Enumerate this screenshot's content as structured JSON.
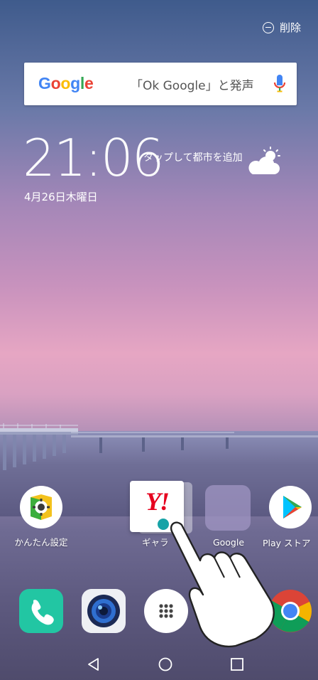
{
  "topbar": {
    "delete_label": "削除"
  },
  "search": {
    "logo": "Google",
    "hint": "「Ok Google」と発声"
  },
  "clock": {
    "time": "21:06",
    "city_tap": "タップして都市を追加",
    "date": "4月26日木曜日"
  },
  "apps": [
    {
      "label": "かんたん設定"
    },
    {
      "label": "ギャラリー",
      "shown": "ギャラ"
    },
    {
      "label": "Google"
    },
    {
      "label": "Play ストア"
    }
  ],
  "dragging": {
    "app": "Yahoo! JAPAN",
    "mark": "Y!"
  },
  "colors": {
    "google_blue": "#4285F4",
    "google_red": "#EA4335",
    "google_yellow": "#FBBC05",
    "google_green": "#34A853",
    "phone_green": "#20c7a4",
    "yahoo_red": "#e6001e"
  }
}
